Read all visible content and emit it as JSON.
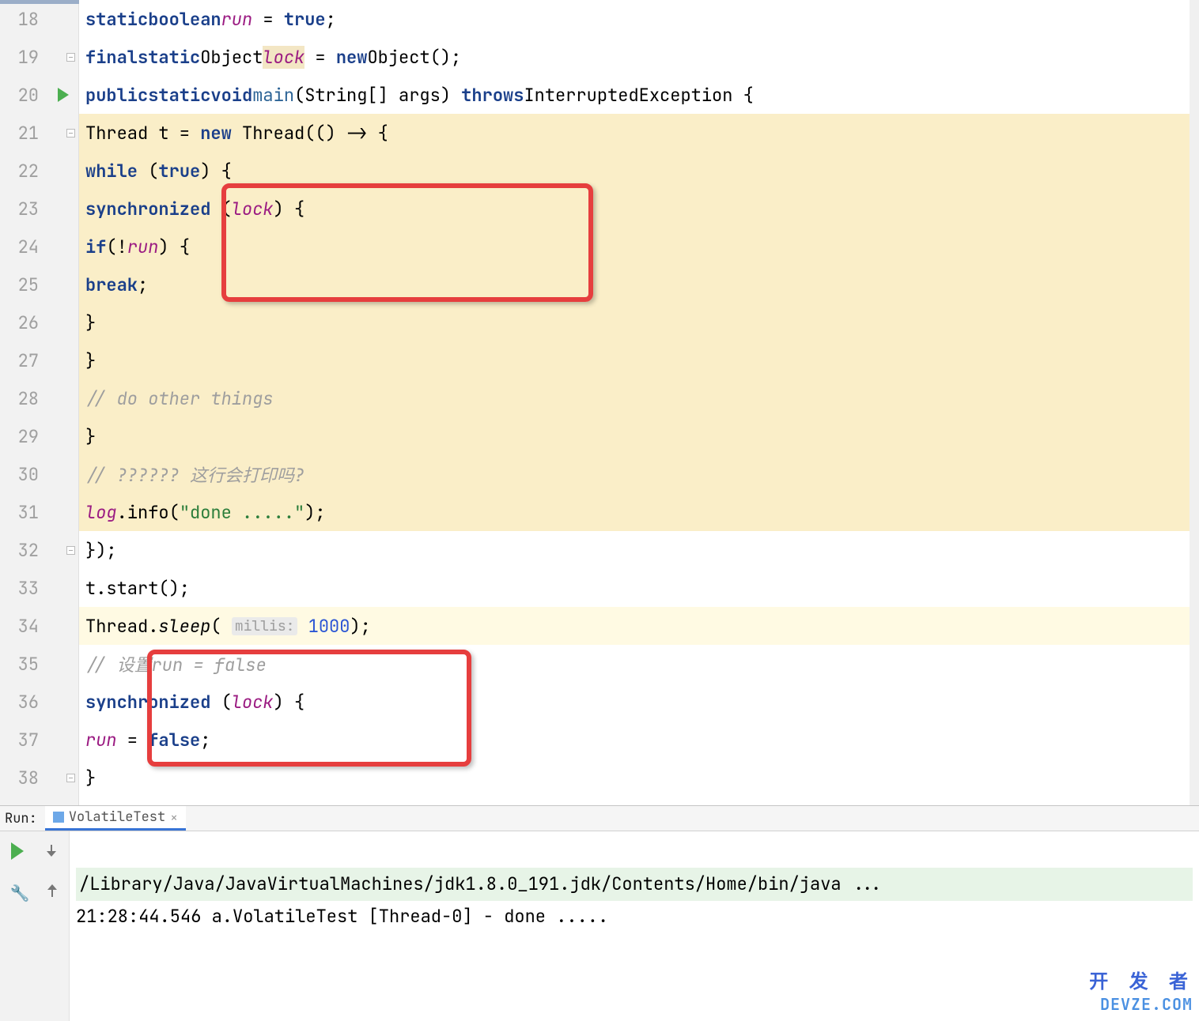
{
  "gutter": {
    "start": 18,
    "end": 38,
    "run_icon_line": 20
  },
  "code": {
    "l18": {
      "kw1": "static",
      "kw2": "boolean",
      "fld": "run",
      "eq": " = ",
      "kw3": "true",
      "semi": ";"
    },
    "l19": {
      "kw1": "final",
      "kw2": "static",
      "ty": "Object",
      "fld": "lock",
      "eq": " = ",
      "kw3": "new",
      "ty2": "Object",
      "tail": "();"
    },
    "l20": {
      "kw1": "public",
      "kw2": "static",
      "kw3": "void",
      "fn": "main",
      "args": "(String[] args) ",
      "kw4": "throws",
      "ex": "InterruptedException {"
    },
    "l21": {
      "pre": "Thread t = ",
      "kw": "new",
      "post": " Thread(() -> {"
    },
    "l22": {
      "kw": "while",
      "cond": " (",
      "kw2": "true",
      "tail": ") {"
    },
    "l23": {
      "kw": "synchronized",
      "open": " (",
      "fld": "lock",
      "close": ") {"
    },
    "l24": {
      "kw": "if",
      "open": "(!",
      "fld": "run",
      "close": ") {"
    },
    "l25": {
      "kw": "break",
      "semi": ";"
    },
    "l26": {
      "brace": "}"
    },
    "l27": {
      "brace": "}"
    },
    "l28": {
      "cmt": "// do other things"
    },
    "l29": {
      "brace": "}"
    },
    "l30": {
      "cmt": "// ?????? 这行会打印吗?"
    },
    "l31": {
      "fld": "log",
      "call": ".info(",
      "str": "\"done .....\"",
      "tail": ");"
    },
    "l32": {
      "text": "});"
    },
    "l33": {
      "text": "t.start();"
    },
    "l34": {
      "pre": "Thread.",
      "fn": "sleep",
      "open": "( ",
      "hint": "millis:",
      "num": " 1000",
      "tail": ");"
    },
    "l35": {
      "cmt": "// 设置run = false"
    },
    "l36": {
      "kw": "synchronized",
      "open": " (",
      "fld": "lock",
      "close": ") {"
    },
    "l37": {
      "fld": "run",
      "mid": " = ",
      "kw": "false",
      "semi": ";"
    },
    "l38": {
      "brace": "}"
    }
  },
  "run_panel": {
    "label": "Run:",
    "tab": "VolatileTest",
    "console_cmd": "/Library/Java/JavaVirtualMachines/jdk1.8.0_191.jdk/Contents/Home/bin/java ...",
    "console_log": "21:28:44.546 a.VolatileTest [Thread-0] - done ....."
  },
  "watermark": {
    "cn": "开 发 者",
    "en": "DEVZE.COM"
  }
}
